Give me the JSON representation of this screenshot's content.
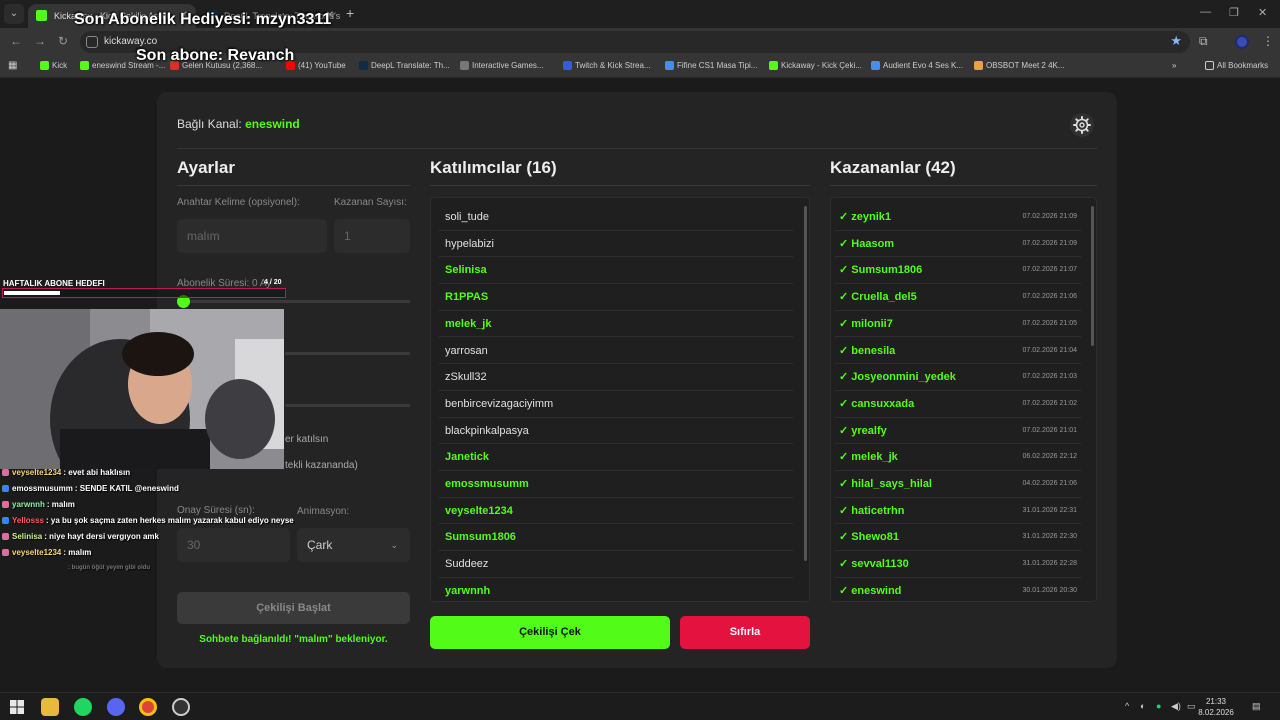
{
  "browser": {
    "tabs": [
      {
        "label": "Kickaway - Kick Çekiliş Aracı",
        "active": true
      },
      {
        "label": "DeepL Translate: The world's",
        "active": false
      }
    ],
    "url": "kickaway.co",
    "bookmarks": [
      {
        "label": "Kick",
        "color": "#53fc18"
      },
      {
        "label": "eneswind Stream -...",
        "color": "#53fc18"
      },
      {
        "label": "Gelen Kutusu (2,368...",
        "color": "#d93025"
      },
      {
        "label": "(41) YouTube",
        "color": "#ff0000"
      },
      {
        "label": "DeepL Translate: Th...",
        "color": "#0f2b46"
      },
      {
        "label": "Interactive Games...",
        "color": "#777777"
      },
      {
        "label": "Twitch & Kick Strea...",
        "color": "#3a5bd9"
      },
      {
        "label": "Fifine CS1 Masa Tipi...",
        "color": "#4a8af4"
      },
      {
        "label": "Kickaway - Kick Çeki...",
        "color": "#53fc18"
      },
      {
        "label": "Audient Evo 4 Ses K...",
        "color": "#4a8af4"
      },
      {
        "label": "OBSBOT Meet 2 4K...",
        "color": "#e8a33d"
      }
    ],
    "all_bookmarks": "All Bookmarks"
  },
  "stream_overlay": {
    "last_gift": "Son Abonelik Hediyesi: mzyn3311",
    "last_sub": "Son abone: Revanch",
    "goal_label": "HAFTALIK ABONE HEDEFI",
    "goal_count": "4 / 20",
    "goal_progress": 0.2
  },
  "app": {
    "channel_label": "Bağlı Kanal:",
    "channel_name": "eneswind",
    "settings": {
      "title": "Ayarlar",
      "keyword_label": "Anahtar Kelime (opsiyonel):",
      "keyword_value": "malım",
      "winner_count_label": "Kazanan Sayısı:",
      "winner_count_value": "1",
      "sub_duration_label": "Abonelik Süresi: 0 Ay",
      "option1_text": "er katılsın",
      "option2_text": "tekli kazananda)",
      "confirm_label": "Onay Süresi (sn):",
      "confirm_value": "30",
      "animation_label": "Animasyon:",
      "animation_value": "Çark",
      "start_button": "Çekilişi Başlat",
      "status": "Sohbete bağlanıldı! \"malım\" bekleniyor."
    },
    "participants": {
      "title": "Katılımcılar (16)",
      "items": [
        {
          "name": "soli_tude",
          "highlight": false
        },
        {
          "name": "hypelabizi",
          "highlight": false
        },
        {
          "name": "Selinisa",
          "highlight": true
        },
        {
          "name": "R1PPAS",
          "highlight": true
        },
        {
          "name": "melek_jk",
          "highlight": true
        },
        {
          "name": "yarrosan",
          "highlight": false
        },
        {
          "name": "zSkull32",
          "highlight": false
        },
        {
          "name": "benbircevizagaciyimm",
          "highlight": false
        },
        {
          "name": "blackpinkalpasya",
          "highlight": false
        },
        {
          "name": "Janetick",
          "highlight": true
        },
        {
          "name": "emossmusumm",
          "highlight": true
        },
        {
          "name": "veyselte1234",
          "highlight": true
        },
        {
          "name": "Sumsum1806",
          "highlight": true
        },
        {
          "name": "Suddeez",
          "highlight": false
        },
        {
          "name": "yarwnnh",
          "highlight": true
        }
      ],
      "draw_button": "Çekilişi Çek",
      "reset_button": "Sıfırla"
    },
    "winners": {
      "title": "Kazananlar (42)",
      "items": [
        {
          "name": "✓ zeynik1",
          "date": "07.02.2026 21:09"
        },
        {
          "name": "✓ Haasom",
          "date": "07.02.2026 21:09"
        },
        {
          "name": "✓ Sumsum1806",
          "date": "07.02.2026 21:07"
        },
        {
          "name": "✓ Cruella_del5",
          "date": "07.02.2026 21:06"
        },
        {
          "name": "✓ milonii7",
          "date": "07.02.2026 21:05"
        },
        {
          "name": "✓ benesila",
          "date": "07.02.2026 21:04"
        },
        {
          "name": "✓ Josyeonmini_yedek",
          "date": "07.02.2026 21:03"
        },
        {
          "name": "✓ cansuxxada",
          "date": "07.02.2026 21:02"
        },
        {
          "name": "✓ yrealfy",
          "date": "07.02.2026 21:01"
        },
        {
          "name": "✓ melek_jk",
          "date": "06.02.2026 22:12"
        },
        {
          "name": "✓ hilal_says_hilal",
          "date": "04.02.2026 21:06"
        },
        {
          "name": "✓ haticetrhn",
          "date": "31.01.2026 22:31"
        },
        {
          "name": "✓ Shewo81",
          "date": "31.01.2026 22:30"
        },
        {
          "name": "✓ sevval1130",
          "date": "31.01.2026 22:28"
        },
        {
          "name": "✓ eneswind",
          "date": "30.01.2026 20:30"
        }
      ]
    }
  },
  "chat": [
    {
      "user": "veyselte1234",
      "msg": ": evet abi haklısın",
      "user_color": "#f5d76e"
    },
    {
      "user": "emossmusumm",
      "msg": ": SENDE KATIL @eneswind",
      "user_color": "#ffffff"
    },
    {
      "user": "yarwnnh",
      "msg": ": malım",
      "user_color": "#8ef0a6"
    },
    {
      "user": "Yellosss",
      "msg": ": ya bu şok saçma zaten herkes malım yazarak kabul ediyo neyse",
      "user_color": "#ff5e5e"
    },
    {
      "user": "Selinisa",
      "msg": ": niye hayt dersi vergıyon amk",
      "user_color": "#c8f58a"
    },
    {
      "user": "veyselte1234",
      "msg": ": malım",
      "user_color": "#f5d76e"
    },
    {
      "user": "",
      "msg": ": bugün öğüt yeyım gibi oldu",
      "user_color": "#777777"
    }
  ],
  "taskbar": {
    "time": "21:33",
    "date": "8.02.2026"
  }
}
